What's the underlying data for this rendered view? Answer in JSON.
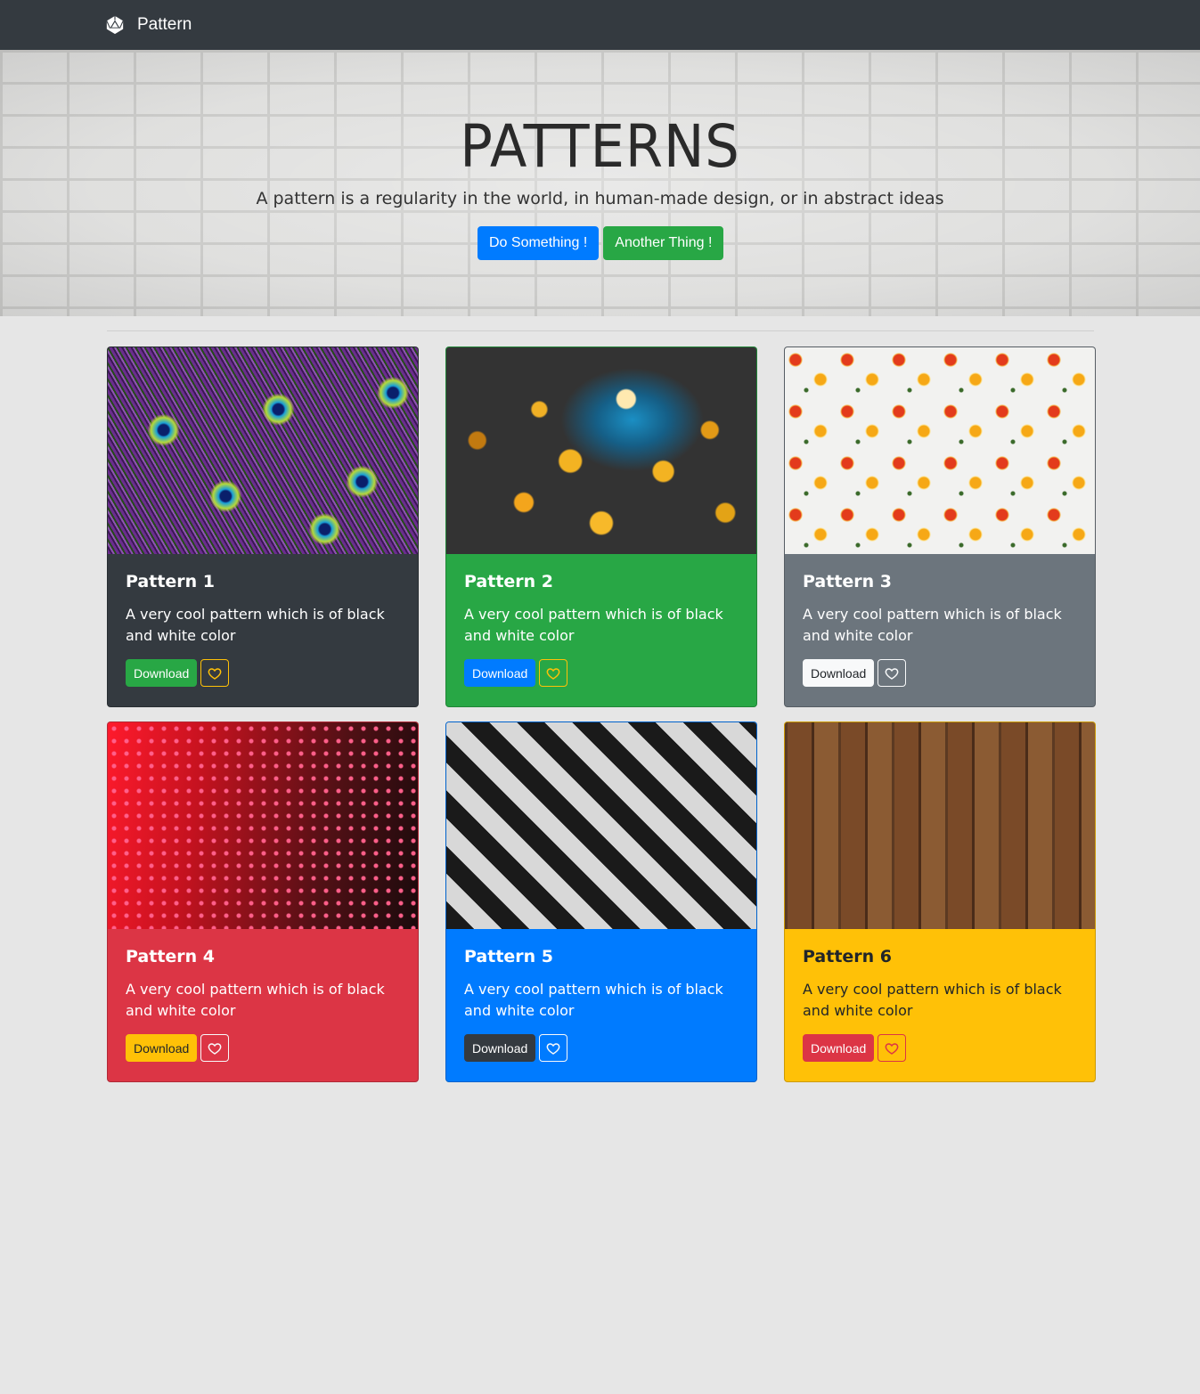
{
  "navbar": {
    "brand": "Pattern",
    "brand_icon": "d20-dice-icon"
  },
  "hero": {
    "title": "PATTERNS",
    "subtitle": "A pattern is a regularity in the world, in human-made design, or in abstract ideas",
    "primary_button": "Do Something !",
    "secondary_button": "Another Thing !"
  },
  "cards": [
    {
      "title": "Pattern 1",
      "text": "A very cool pattern which is of black and white color",
      "download": "Download"
    },
    {
      "title": "Pattern 2",
      "text": "A very cool pattern which is of black and white color",
      "download": "Download"
    },
    {
      "title": "Pattern 3",
      "text": "A very cool pattern which is of black and white color",
      "download": "Download"
    },
    {
      "title": "Pattern 4",
      "text": "A very cool pattern which is of black and white color",
      "download": "Download"
    },
    {
      "title": "Pattern 5",
      "text": "A very cool pattern which is of black and white color",
      "download": "Download"
    },
    {
      "title": "Pattern 6",
      "text": "A very cool pattern which is of black and white color",
      "download": "Download"
    }
  ],
  "colors": {
    "navbar": "#343a40",
    "page_background": "#e6e6e6",
    "primary": "#007bff",
    "success": "#28a745",
    "secondary": "#6c757d",
    "danger": "#dc3545",
    "warning": "#ffc107",
    "dark": "#343a40"
  },
  "icons": {
    "favorite": "heart-outline-icon"
  }
}
